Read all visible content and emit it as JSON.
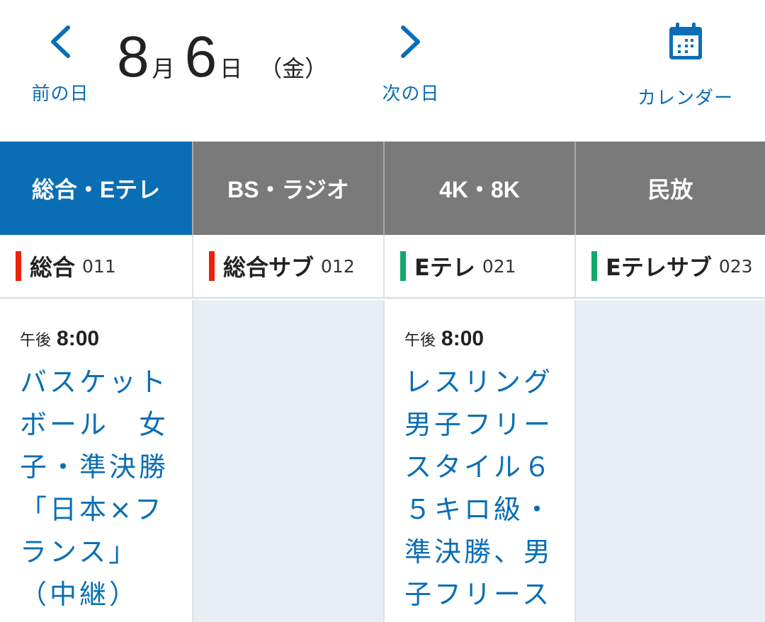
{
  "header": {
    "prev_label": "前の日",
    "next_label": "次の日",
    "calendar_label": "カレンダー",
    "month": "8",
    "month_unit": "月",
    "day": "6",
    "day_unit": "日",
    "weekday": "（金）"
  },
  "tabs": [
    {
      "label": "総合・Eテレ",
      "active": true
    },
    {
      "label": "BS・ラジオ",
      "active": false
    },
    {
      "label": "4K・8K",
      "active": false
    },
    {
      "label": "民放",
      "active": false
    }
  ],
  "channels": [
    {
      "name": "総合",
      "number": "011",
      "color": "#ee2200"
    },
    {
      "name": "総合サブ",
      "number": "012",
      "color": "#ee2200"
    },
    {
      "name": "Eテレ",
      "number": "021",
      "color": "#12a86a"
    },
    {
      "name": "Eテレサブ",
      "number": "023",
      "color": "#12a86a"
    }
  ],
  "programs": [
    {
      "ampm": "午後",
      "time": "8:00",
      "title": "バスケットボール　女子・準決勝「日本×フランス」（中継）"
    },
    null,
    {
      "ampm": "午後",
      "time": "8:00",
      "title": "レスリング男子フリースタイル６５キロ級・準決勝、男子フリース"
    },
    null
  ],
  "colors": {
    "accent": "#0a6eb4",
    "tab_inactive": "#7a7a7a",
    "empty_cell": "#e9edf4"
  }
}
